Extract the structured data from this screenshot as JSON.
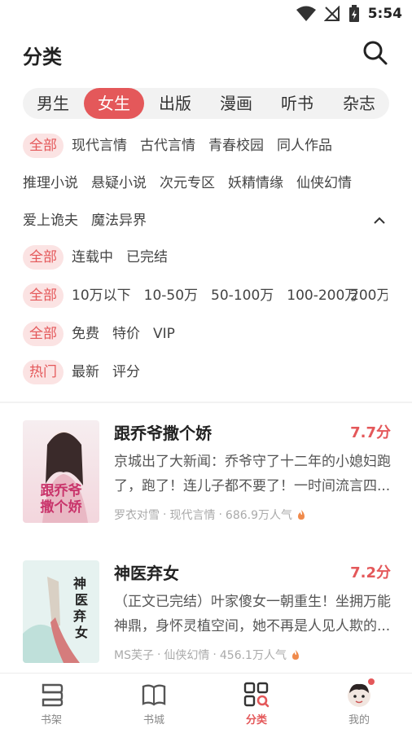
{
  "status_bar": {
    "time": "5:54"
  },
  "header": {
    "title": "分类"
  },
  "tabs": [
    {
      "label": "男生"
    },
    {
      "label": "女生",
      "active": true
    },
    {
      "label": "出版"
    },
    {
      "label": "漫画"
    },
    {
      "label": "听书"
    },
    {
      "label": "杂志"
    }
  ],
  "filters": {
    "genre_row1": [
      "全部",
      "现代言情",
      "古代言情",
      "青春校园",
      "同人作品"
    ],
    "genre_row2": [
      "推理小说",
      "悬疑小说",
      "次元专区",
      "妖精情缘",
      "仙侠幻情"
    ],
    "genre_row3": [
      "爱上诡夫",
      "魔法异界"
    ],
    "status": [
      "全部",
      "连载中",
      "已完结"
    ],
    "words": [
      "全部",
      "10万以下",
      "10-50万",
      "50-100万",
      "100-200万",
      "200万"
    ],
    "price": [
      "全部",
      "免费",
      "特价",
      "VIP"
    ],
    "sort": [
      "热门",
      "最新",
      "评分"
    ]
  },
  "books": [
    {
      "title": "跟乔爷撒个娇",
      "score": "7.7分",
      "desc": "京城出了大新闻：乔爷守了十二年的小媳妇跑了，跑了！连儿子都不要了！一时间流言四...",
      "author": "罗衣对雪",
      "category": "现代言情",
      "popularity": "686.9万人气",
      "cover_text": "跟乔爷撒个娇"
    },
    {
      "title": "神医弃女",
      "score": "7.2分",
      "desc": "（正文已完结）叶家傻女一朝重生！坐拥万能神鼎，身怀灵植空间，她不再是人见人欺的...",
      "author": "MS芙子",
      "category": "仙侠幻情",
      "popularity": "456.1万人气",
      "cover_text": "神医弃女"
    }
  ],
  "bottom_nav": [
    {
      "label": "书架",
      "icon": "bookshelf-icon"
    },
    {
      "label": "书城",
      "icon": "book-icon"
    },
    {
      "label": "分类",
      "icon": "category-icon",
      "active": true
    },
    {
      "label": "我的",
      "icon": "avatar-icon",
      "badge": true
    }
  ],
  "colors": {
    "accent": "#e4585a",
    "chip_bg": "#fbe3e3",
    "tab_bg": "#f2f2f2"
  }
}
